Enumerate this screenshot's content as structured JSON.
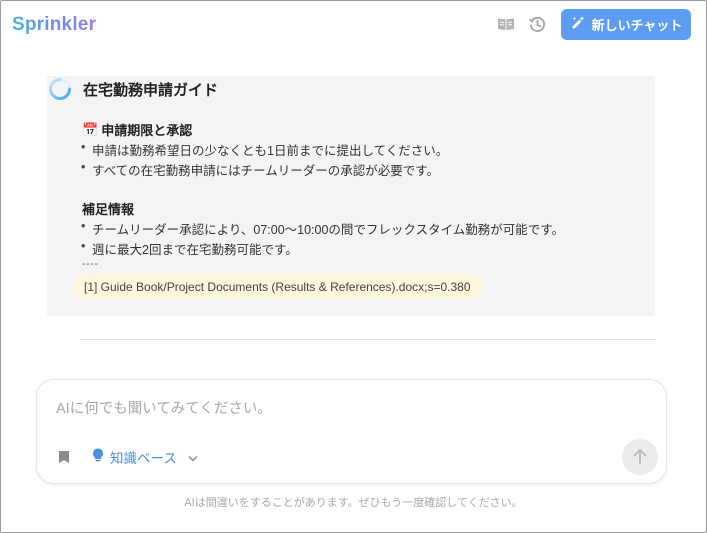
{
  "app": {
    "logo_text": "Sprinkler"
  },
  "header": {
    "new_chat_label": "新しいチャット",
    "icons": [
      "book-open-icon",
      "history-icon",
      "magic-pen-icon"
    ]
  },
  "message": {
    "title": "在宅勤務申請ガイド",
    "sections": [
      {
        "emoji": "📅",
        "heading": "申請期限と承認",
        "bullets": [
          "申請は勤務希望日の少なくとも1日前までに提出してください。",
          "すべての在宅勤務申請にはチームリーダーの承認が必要です。"
        ]
      },
      {
        "heading": "補足情報",
        "bullets": [
          "チームリーダー承認により、07:00〜10:00の間でフレックスタイム勤務が可能です。",
          "週に最大2回まで在宅勤務可能です。"
        ]
      }
    ],
    "separator": "----",
    "reference": "[1] Guide Book/Project Documents (Results & References).docx;s=0.380"
  },
  "composer": {
    "placeholder": "AIに何でも聞いてみてください。",
    "value": "",
    "knowledge_base_label": "知識ベース"
  },
  "footer": {
    "disclaimer": "AIは間違いをすることがあります。ぜひもう一度確認してください。"
  },
  "colors": {
    "accent": "#5c9cf2",
    "link": "#4a90e2",
    "message_bg": "#f4f4f6",
    "reference_bg": "#fbf6dc"
  }
}
